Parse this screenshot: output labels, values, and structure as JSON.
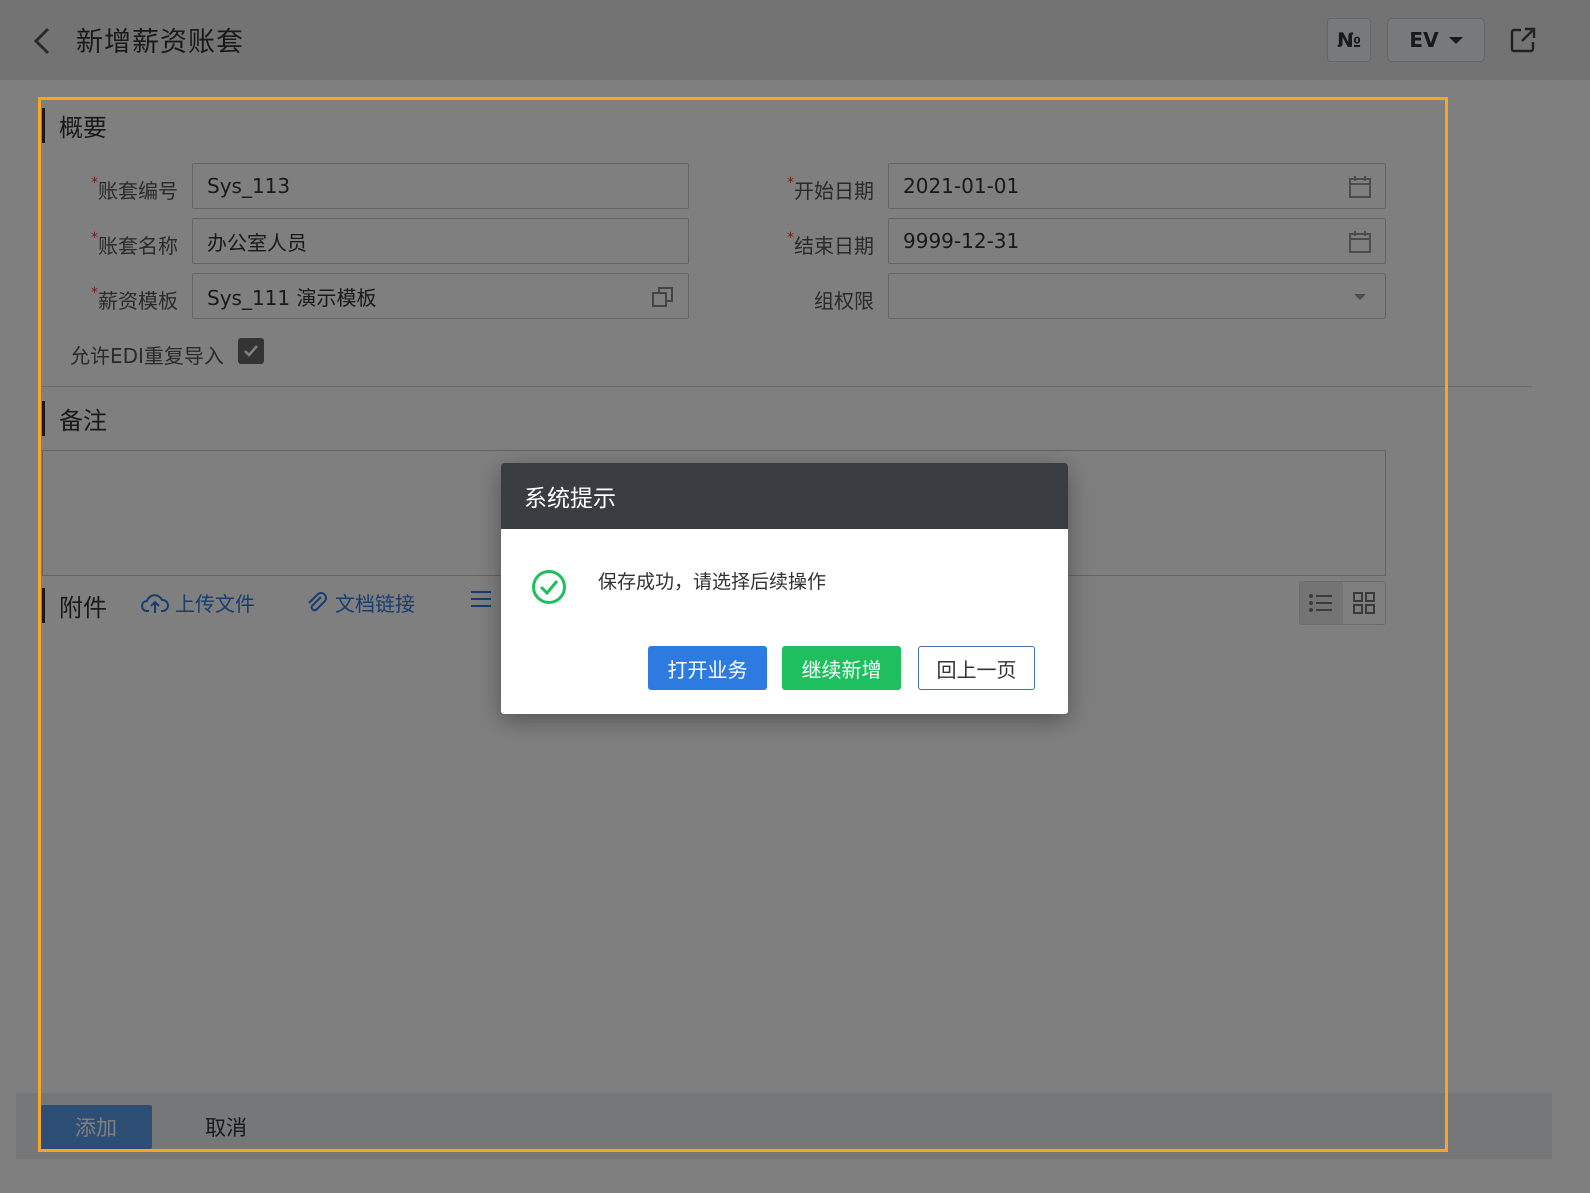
{
  "header": {
    "title": "新增薪资账套",
    "no_button": "№",
    "lang_button": "EV"
  },
  "summary": {
    "section_title": "概要",
    "fields": {
      "account_no": {
        "label": "账套编号",
        "value": "Sys_113"
      },
      "account_name": {
        "label": "账套名称",
        "value": "办公室人员"
      },
      "salary_template": {
        "label": "薪资模板",
        "value": "Sys_111 演示模板"
      },
      "start_date": {
        "label": "开始日期",
        "value": "2021-01-01"
      },
      "end_date": {
        "label": "结束日期",
        "value": "9999-12-31"
      },
      "group_permission": {
        "label": "组权限",
        "value": ""
      }
    },
    "edi_checkbox": {
      "label": "允许EDI重复导入",
      "checked": true
    },
    "required_mark": "*"
  },
  "remark": {
    "section_title": "备注",
    "value": ""
  },
  "attachment": {
    "section_title": "附件",
    "upload_label": "上传文件",
    "doc_link_label": "文档链接"
  },
  "footer": {
    "add_label": "添加",
    "cancel_label": "取消"
  },
  "dialog": {
    "title": "系统提示",
    "message": "保存成功，请选择后续操作",
    "buttons": {
      "open": "打开业务",
      "continue": "继续新增",
      "back": "回上一页"
    }
  },
  "colors": {
    "highlight_frame": "#f5a623",
    "primary_blue": "#2d7be0",
    "success_green": "#1fbf5f",
    "dialog_header": "#393d42"
  }
}
